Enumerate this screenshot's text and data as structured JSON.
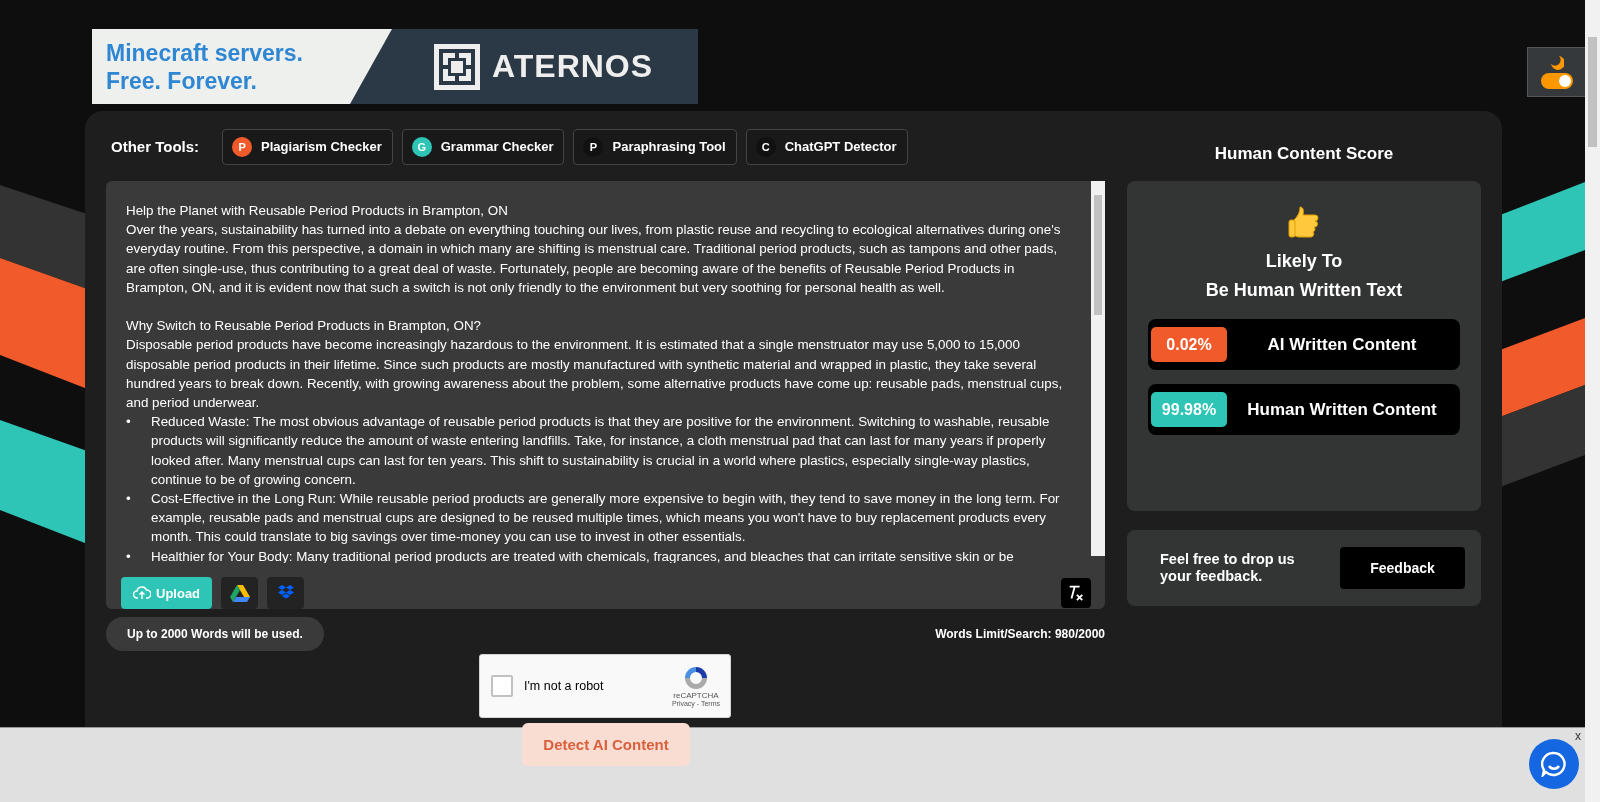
{
  "ad_banner": {
    "tagline_lines": [
      "Minecraft servers.",
      "Free. Forever."
    ],
    "brand": "ATERNOS"
  },
  "theme_toggle": {
    "on": true
  },
  "other_tools": {
    "label": "Other Tools:",
    "tools": [
      {
        "letter": "P",
        "label": "Plagiarism Checker",
        "color": "#f15a2b"
      },
      {
        "letter": "G",
        "label": "Grammar Checker",
        "color": "#2ec4b6"
      },
      {
        "letter": "P",
        "label": "Paraphrasing Tool",
        "color": "#111111"
      },
      {
        "letter": "C",
        "label": "ChatGPT Detector",
        "color": "#111111"
      }
    ]
  },
  "editor": {
    "paragraphs": [
      {
        "kind": "text",
        "text": "Help the Planet with Reusable Period Products in Brampton, ON"
      },
      {
        "kind": "text",
        "text": "Over the years, sustainability has turned into a debate on everything touching our lives, from plastic reuse and recycling to ecological alternatives during one's everyday routine. From this perspective, a domain in which many are shifting is menstrual care. Traditional period products, such as tampons and other pads, are often single-use, thus contributing to a great deal of waste. Fortunately, people are becoming aware of the benefits of Reusable Period Products in Brampton, ON, and it is evident now that such a switch is not only friendly to the environment but very soothing for personal health as well."
      },
      {
        "kind": "blank"
      },
      {
        "kind": "text",
        "text": "Why Switch to Reusable Period Products in Brampton, ON?"
      },
      {
        "kind": "text",
        "text": "Disposable period products have become increasingly hazardous to the environment. It is estimated that a single menstruator may use 5,000 to 15,000 disposable period products in their lifetime. Since such products are mostly manufactured with synthetic material and wrapped in plastic, they take several hundred years to break down. Recently, with growing awareness about the problem, some alternative products have come up: reusable pads, menstrual cups, and period underwear."
      },
      {
        "kind": "bullet",
        "bullet": "•",
        "text": "Reduced Waste: The most obvious advantage of reusable period products is that they are positive for the environment. Switching to washable, reusable products will significantly reduce the amount of waste entering landfills. Take, for instance, a cloth menstrual pad that can last for many years if properly looked after. Many menstrual cups can last for ten years. This shift to sustainability is crucial in a world where plastics, especially single-way plastics, continue to be of growing concern."
      },
      {
        "kind": "bullet",
        "bullet": "•",
        "text": "Cost-Effective in the Long Run: While reusable period products are generally more expensive to begin with, they tend to save money in the long term. For example, reusable pads and menstrual cups are designed to be reused multiple times, which means you won't have to buy replacement products every month. This could translate to big savings over time-money you can use to invest in other essentials."
      },
      {
        "kind": "bullet",
        "bullet": "•",
        "text": "Healthier for Your Body: Many traditional period products are treated with chemicals, fragrances, and bleaches that can irritate sensitive skin or be"
      }
    ],
    "upload_label": "Upload"
  },
  "word_note": "Up to 2000 Words will be used.",
  "word_count": "Words Limit/Search: 980/2000",
  "captcha": {
    "checked": false,
    "label": "I'm not a robot",
    "brand": "reCAPTCHA",
    "links": "Privacy - Terms"
  },
  "detect_button": {
    "label": "Detect AI Content",
    "disabled": true
  },
  "score": {
    "title": "Human Content Score",
    "verdict_lines": [
      "Likely To",
      "Be Human Written Text"
    ],
    "results": [
      {
        "value": "0.02%",
        "label": "AI Written Content",
        "color": "#f15a2b"
      },
      {
        "value": "99.98%",
        "label": "Human Written Content",
        "color": "#2ec4b6"
      }
    ]
  },
  "feedback": {
    "text": "Feel free to drop us your feedback.",
    "button": "Feedback"
  },
  "bottom_bar": {
    "close": "x"
  }
}
